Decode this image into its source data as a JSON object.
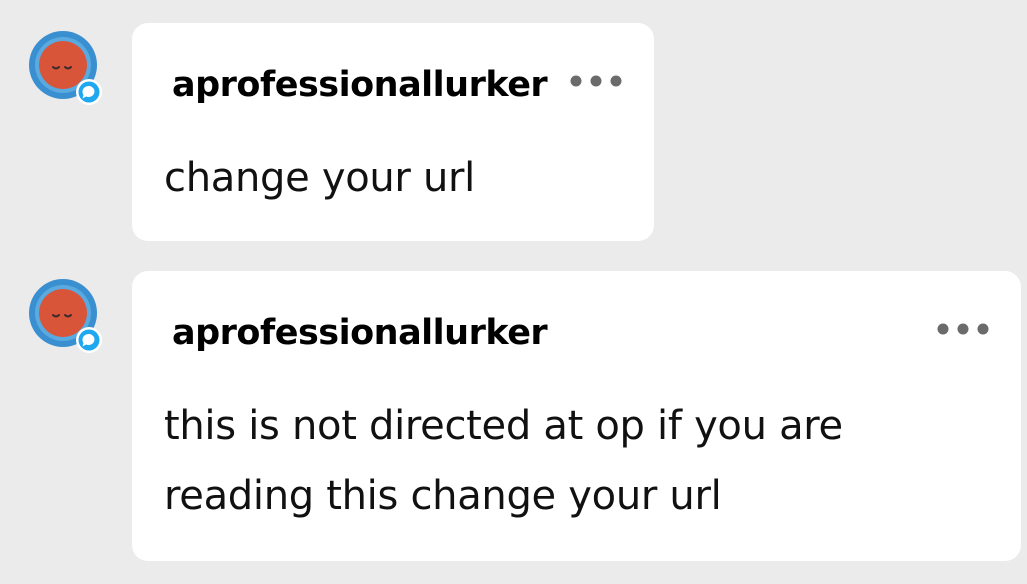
{
  "replies": [
    {
      "username": "aprofessionallurker",
      "message": "change your url",
      "avatar_icon": "sleepy-face-avatar",
      "badge_icon": "speech-bubble-icon",
      "menu_icon": "more-options-icon"
    },
    {
      "username": "aprofessionallurker",
      "message": "this is not directed at op if you are reading this change your url",
      "avatar_icon": "sleepy-face-avatar",
      "badge_icon": "speech-bubble-icon",
      "menu_icon": "more-options-icon"
    }
  ],
  "colors": {
    "background": "#ebebeb",
    "bubble": "#ffffff",
    "avatar_ring": "#3a8fd0",
    "avatar_face": "#d9553a",
    "badge": "#1fa7f0"
  }
}
